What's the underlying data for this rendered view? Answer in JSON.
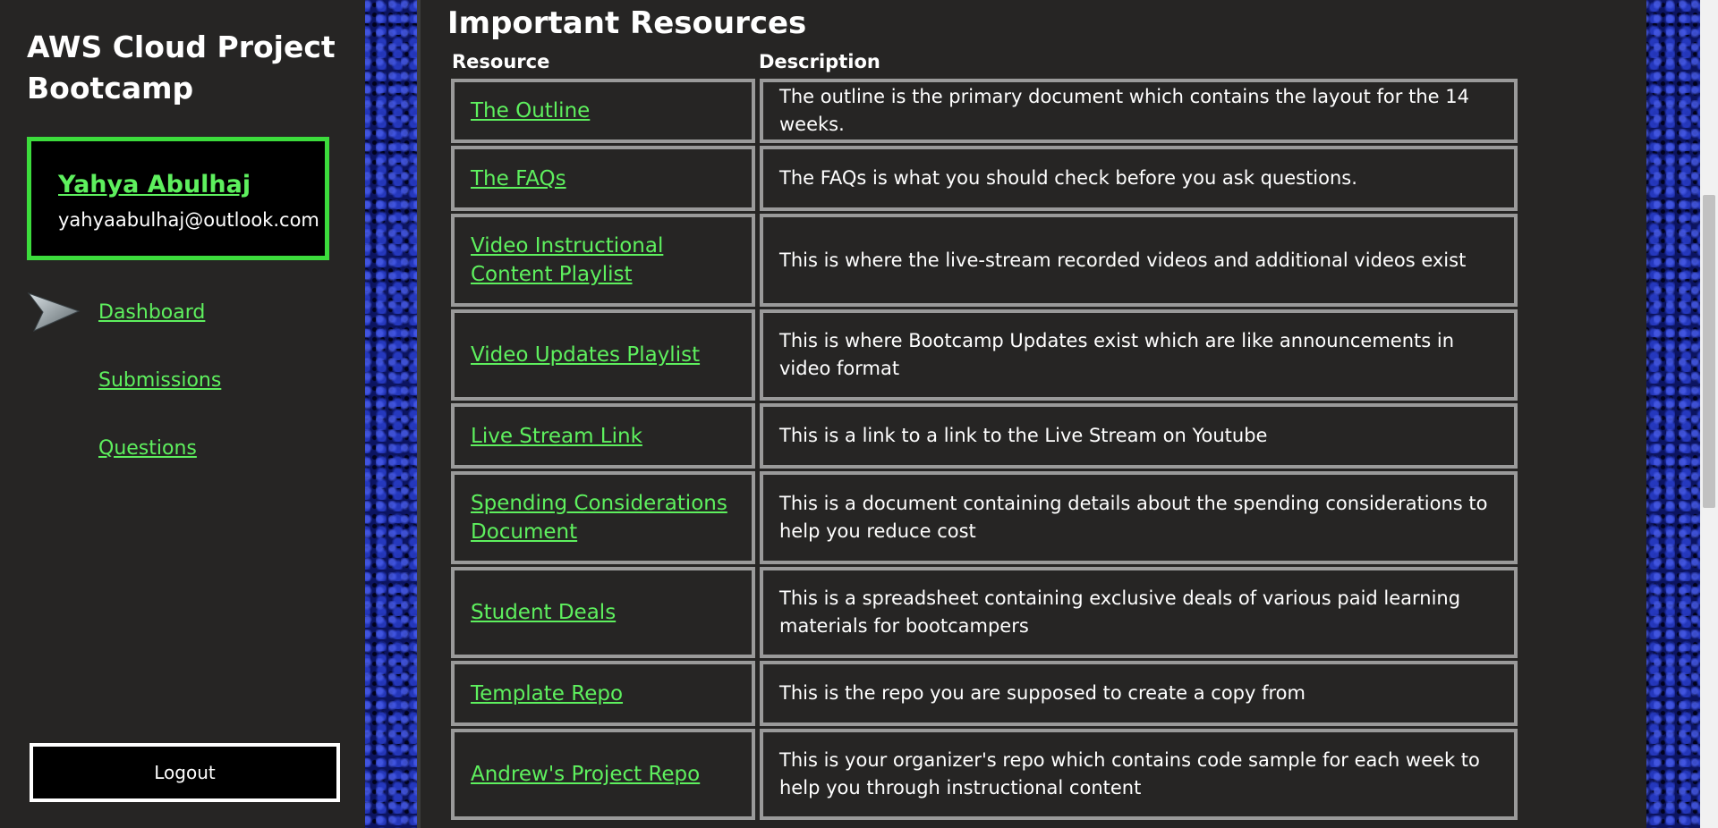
{
  "sidebar": {
    "title": "AWS Cloud Project Bootcamp",
    "user": {
      "name": "Yahya Abulhaj",
      "email": "yahyaabulhaj@outlook.com"
    },
    "nav": [
      {
        "label": "Dashboard",
        "active": true,
        "icon": "arrow-pointer-icon"
      },
      {
        "label": "Submissions",
        "active": false
      },
      {
        "label": "Questions",
        "active": false
      }
    ],
    "logout_label": "Logout"
  },
  "main": {
    "title": "Important Resources",
    "columns": [
      "Resource",
      "Description"
    ],
    "rows": [
      {
        "resource": "The Outline",
        "description": "The outline is the primary document which contains the layout for the 14 weeks."
      },
      {
        "resource": "The FAQs",
        "description": "The FAQs is what you should check before you ask questions."
      },
      {
        "resource": "Video Instructional Content Playlist",
        "description": "This is where the live-stream recorded videos and additional videos exist"
      },
      {
        "resource": "Video Updates Playlist",
        "description": "This is where Bootcamp Updates exist which are like announcements in video format"
      },
      {
        "resource": "Live Stream Link",
        "description": "This is a link to a link to the Live Stream on Youtube"
      },
      {
        "resource": "Spending Considerations Document",
        "description": "This is a document containing details about the spending considerations to help you reduce cost"
      },
      {
        "resource": "Student Deals",
        "description": "This is a spreadsheet containing exclusive deals of various paid learning materials for bootcampers"
      },
      {
        "resource": "Template Repo",
        "description": "This is the repo you are supposed to create a copy from"
      },
      {
        "resource": "Andrew's Project Repo",
        "description": "This is your organizer's repo which contains code sample for each week to help you through instructional content"
      }
    ]
  },
  "colors": {
    "accent": "#5ef05e",
    "card_border": "#3cdc3c",
    "panel": "#262524",
    "cell_border": "#9a9a9a"
  }
}
